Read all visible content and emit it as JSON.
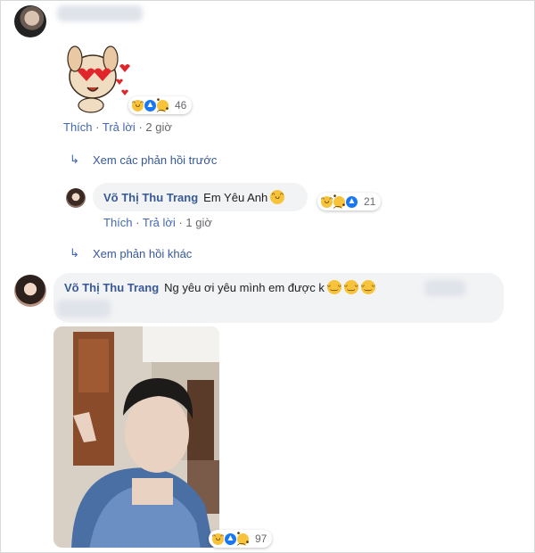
{
  "comment_top": {
    "reactions": {
      "count": "46"
    },
    "actions": {
      "like": "Thích",
      "reply": "Trả lời",
      "separator": "·",
      "time": "2 giờ"
    }
  },
  "previous_replies_link": "Xem các phản hồi trước",
  "reply": {
    "author": "Võ Thị Thu Trang",
    "text": "Em Yêu Anh",
    "reactions": {
      "count": "21"
    },
    "actions": {
      "like": "Thích",
      "reply": "Trả lời",
      "separator": "·",
      "time": "1 giờ"
    }
  },
  "other_replies_link": "Xem phản hồi khác",
  "comment_main": {
    "author": "Võ Thị Thu Trang",
    "text": "Ng yêu ơi yêu mình em được k",
    "reactions": {
      "count": "97"
    }
  },
  "colors": {
    "link_blue": "#4267b2",
    "author_blue": "#385898",
    "bubble_bg": "#f2f3f5",
    "meta_gray": "#65676b"
  },
  "icons": {
    "reaction_haha": "haha-reaction-icon",
    "reaction_like": "like-reaction-icon",
    "reaction_sad": "sad-reaction-icon",
    "reply_arrow": "reply-arrow-icon",
    "emoji": "emoji-icon"
  }
}
